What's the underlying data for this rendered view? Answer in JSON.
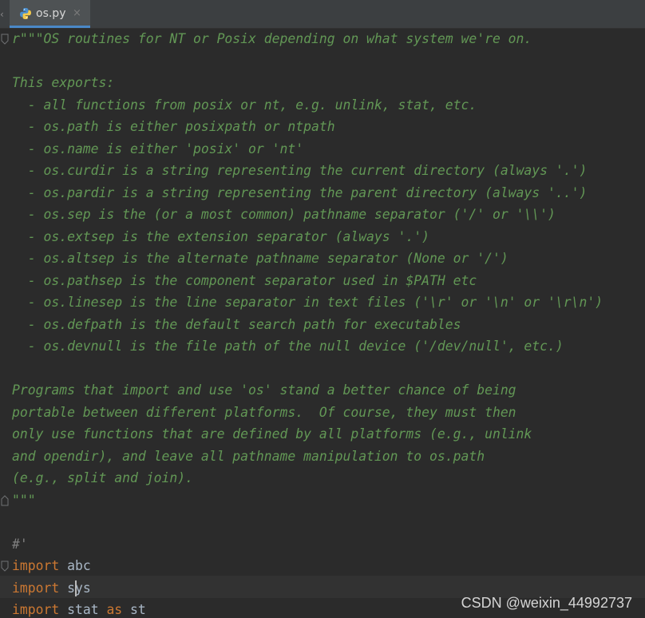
{
  "tab": {
    "filename": "os.py",
    "close_glyph": "×",
    "scroll_left_glyph": "‹",
    "icon": "python-file-icon"
  },
  "code": {
    "lines": [
      {
        "kind": "doc",
        "text": "r\"\"\"OS routines for NT or Posix depending on what system we're on."
      },
      {
        "kind": "doc",
        "text": ""
      },
      {
        "kind": "doc",
        "text": "This exports:"
      },
      {
        "kind": "doc",
        "text": "  - all functions from posix or nt, e.g. unlink, stat, etc."
      },
      {
        "kind": "doc",
        "text": "  - os.path is either posixpath or ntpath"
      },
      {
        "kind": "doc",
        "text": "  - os.name is either 'posix' or 'nt'"
      },
      {
        "kind": "doc",
        "text": "  - os.curdir is a string representing the current directory (always '.')"
      },
      {
        "kind": "doc",
        "text": "  - os.pardir is a string representing the parent directory (always '..')"
      },
      {
        "kind": "doc",
        "text": "  - os.sep is the (or a most common) pathname separator ('/' or '\\\\')"
      },
      {
        "kind": "doc",
        "text": "  - os.extsep is the extension separator (always '.')"
      },
      {
        "kind": "doc",
        "text": "  - os.altsep is the alternate pathname separator (None or '/')"
      },
      {
        "kind": "doc",
        "text": "  - os.pathsep is the component separator used in $PATH etc"
      },
      {
        "kind": "doc",
        "text": "  - os.linesep is the line separator in text files ('\\r' or '\\n' or '\\r\\n')"
      },
      {
        "kind": "doc",
        "text": "  - os.defpath is the default search path for executables"
      },
      {
        "kind": "doc",
        "text": "  - os.devnull is the file path of the null device ('/dev/null', etc.)"
      },
      {
        "kind": "doc",
        "text": ""
      },
      {
        "kind": "doc",
        "text": "Programs that import and use 'os' stand a better chance of being"
      },
      {
        "kind": "doc",
        "text": "portable between different platforms.  Of course, they must then"
      },
      {
        "kind": "doc",
        "text": "only use functions that are defined by all platforms (e.g., unlink"
      },
      {
        "kind": "doc",
        "text": "and opendir), and leave all pathname manipulation to os.path"
      },
      {
        "kind": "doc",
        "text": "(e.g., split and join)."
      },
      {
        "kind": "doc",
        "text": "\"\"\""
      },
      {
        "kind": "blank",
        "text": ""
      },
      {
        "kind": "comment",
        "text": "#'"
      },
      {
        "kind": "import",
        "keyword": "import",
        "module": " abc"
      },
      {
        "kind": "import",
        "keyword": "import",
        "module": " sys"
      },
      {
        "kind": "import_as",
        "keyword": "import",
        "module": " stat ",
        "as_keyword": "as",
        "alias": " st"
      }
    ]
  },
  "colors": {
    "background": "#2b2b2b",
    "docstring": "#629755",
    "keyword": "#cc7832",
    "identifier": "#a9b7c6",
    "comment": "#808080",
    "tab_accent": "#4a88c7"
  },
  "watermark": "CSDN @weixin_44992737"
}
